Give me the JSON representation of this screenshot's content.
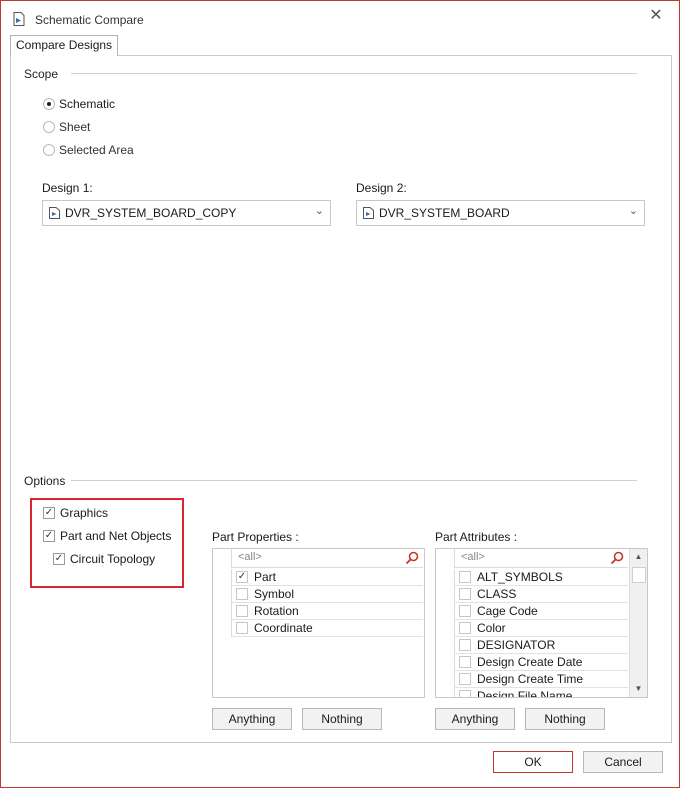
{
  "window": {
    "title": "Schematic Compare",
    "close_glyph": "✕"
  },
  "tabs": [
    {
      "label": "Compare Designs"
    }
  ],
  "scope": {
    "label": "Scope",
    "options": [
      {
        "label": "Schematic",
        "selected": true
      },
      {
        "label": "Sheet",
        "selected": false
      },
      {
        "label": "Selected Area",
        "selected": false
      }
    ]
  },
  "design1": {
    "label": "Design 1:",
    "value": "DVR_SYSTEM_BOARD_COPY"
  },
  "design2": {
    "label": "Design 2:",
    "value": "DVR_SYSTEM_BOARD"
  },
  "options": {
    "label": "Options",
    "graphics": {
      "label": "Graphics",
      "checked": true
    },
    "part_net": {
      "label": "Part and Net Objects",
      "checked": true
    },
    "circuit_topology": {
      "label": "Circuit Topology",
      "checked": true
    }
  },
  "part_properties": {
    "label": "Part Properties :",
    "filter_placeholder": "<all>",
    "items": [
      {
        "label": "Part",
        "checked": true
      },
      {
        "label": "Symbol",
        "checked": false
      },
      {
        "label": "Rotation",
        "checked": false
      },
      {
        "label": "Coordinate",
        "checked": false
      }
    ],
    "anything_label": "Anything",
    "nothing_label": "Nothing"
  },
  "part_attributes": {
    "label": "Part Attributes :",
    "filter_placeholder": "<all>",
    "items": [
      {
        "label": "ALT_SYMBOLS",
        "checked": false
      },
      {
        "label": "CLASS",
        "checked": false
      },
      {
        "label": "Cage Code",
        "checked": false
      },
      {
        "label": "Color",
        "checked": false
      },
      {
        "label": "DESIGNATOR",
        "checked": false
      },
      {
        "label": "Design Create Date",
        "checked": false
      },
      {
        "label": "Design Create Time",
        "checked": false
      },
      {
        "label": "Design File Name",
        "checked": false
      }
    ],
    "anything_label": "Anything",
    "nothing_label": "Nothing"
  },
  "footer": {
    "ok_label": "OK",
    "cancel_label": "Cancel"
  },
  "colors": {
    "highlight_border": "#d9262e",
    "window_border": "#c0392b"
  }
}
